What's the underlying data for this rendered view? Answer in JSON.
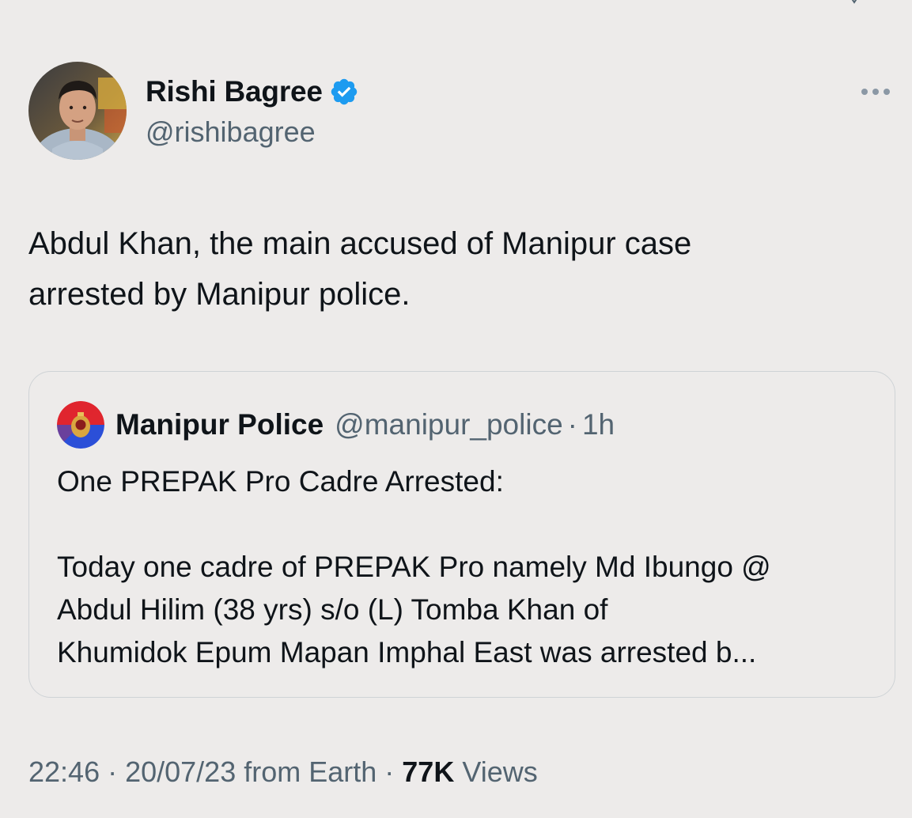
{
  "tweet": {
    "author": {
      "name": "Rishi Bagree",
      "handle": "@rishibagree",
      "verified": true
    },
    "text": "Abdul Khan, the main accused of Manipur case\narrested by Manipur police.",
    "quoted": {
      "author": "Manipur Police",
      "handle": "@manipur_police",
      "separator": "·",
      "time": "1h",
      "text": "One PREPAK Pro Cadre Arrested:\n\nToday one cadre of PREPAK Pro namely Md Ibungo @\nAbdul Hilim (38 yrs) s/o (L) Tomba Khan of\nKhumidok Epum Mapan Imphal East was arrested b..."
    },
    "meta": {
      "time": "22:46",
      "sep1": "·",
      "date": "20/07/23",
      "source": "from Earth",
      "sep2": "·",
      "views_count": "77K",
      "views_label": "Views"
    }
  },
  "colors": {
    "background": "#edebea",
    "text_primary": "#0f1419",
    "text_secondary": "#536471",
    "verified_blue": "#1d9bf0",
    "card_border": "#cfd3d6"
  },
  "icons": {
    "verified": "verified-badge-icon",
    "more": "more-options-icon"
  }
}
